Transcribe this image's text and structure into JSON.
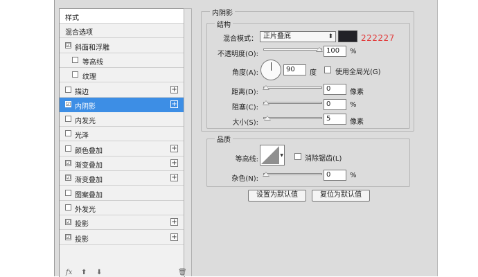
{
  "styles_panel": {
    "items": [
      {
        "label": "样式",
        "type": "header"
      },
      {
        "label": "混合选项",
        "type": "plain"
      },
      {
        "label": "斜面和浮雕",
        "checked": true,
        "check_mark": "☑"
      },
      {
        "label": "等高线",
        "checked": false,
        "indent": true
      },
      {
        "label": "纹理",
        "checked": false,
        "indent": true
      },
      {
        "label": "描边",
        "checked": false,
        "plus": "+"
      },
      {
        "label": "内阴影",
        "checked": true,
        "check_mark": "☑",
        "plus": "+",
        "selected": true
      },
      {
        "label": "内发光",
        "checked": false
      },
      {
        "label": "光泽",
        "checked": false
      },
      {
        "label": "颜色叠加",
        "checked": false,
        "plus": "+"
      },
      {
        "label": "渐变叠加",
        "checked": true,
        "check_mark": "☑",
        "plus": "+"
      },
      {
        "label": "渐变叠加",
        "checked": true,
        "check_mark": "☑",
        "plus": "+"
      },
      {
        "label": "图案叠加",
        "checked": false
      },
      {
        "label": "外发光",
        "checked": false
      },
      {
        "label": "投影",
        "checked": true,
        "check_mark": "☑",
        "plus": "+"
      },
      {
        "label": "投影",
        "checked": true,
        "check_mark": "☑",
        "plus": "+"
      }
    ],
    "bottom": {
      "fx": "fx",
      "up": "⬆",
      "down": "⬇",
      "trash": "🗑"
    }
  },
  "inner_shadow": {
    "title": "内阴影",
    "structure": {
      "title": "结构",
      "blend_mode_label": "混合模式：",
      "blend_mode_value": "正片叠底",
      "blend_mode_arrow": "⬍",
      "color_hex": "222227",
      "swatch_color": "#222227",
      "opacity_label": "不透明度(O):",
      "opacity_value": "100",
      "opacity_unit": "%",
      "opacity_fraction": 1.0,
      "angle_label": "角度(A):",
      "angle_value": "90",
      "angle_unit": "度",
      "global_light_label": "使用全局光(G)",
      "global_light_checked": false,
      "distance_label": "距离(D):",
      "distance_value": "0",
      "distance_unit": "像素",
      "distance_fraction": 0.0,
      "choke_label": "阻塞(C):",
      "choke_value": "0",
      "choke_unit": "%",
      "choke_fraction": 0.0,
      "size_label": "大小(S):",
      "size_value": "5",
      "size_unit": "像素",
      "size_fraction": 0.02
    },
    "quality": {
      "title": "品质",
      "contour_label": "等高线:",
      "antialias_label": "消除锯齿(L)",
      "antialias_checked": false,
      "noise_label": "杂色(N):",
      "noise_value": "0",
      "noise_unit": "%",
      "noise_fraction": 0.0
    },
    "buttons": {
      "set_default": "设置为默认值",
      "reset_default": "复位为默认值"
    }
  }
}
